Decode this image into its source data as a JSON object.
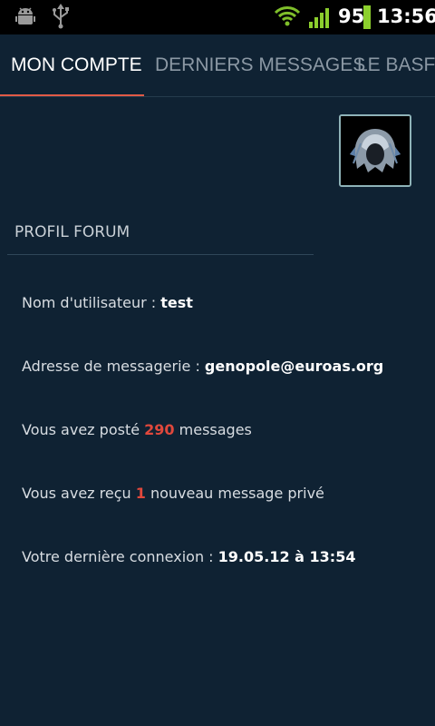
{
  "status_bar": {
    "battery_level": "95",
    "time": "13:56",
    "icons": [
      "android-debug-icon",
      "usb-icon",
      "wifi-icon",
      "signal-icon",
      "battery-icon"
    ]
  },
  "tabs": [
    {
      "label": "MON COMPTE",
      "active": true
    },
    {
      "label": "DERNIERS MESSAGES",
      "active": false
    },
    {
      "label": "LE BASFI",
      "active": false
    }
  ],
  "colors": {
    "background": "#0f2233",
    "accent": "#e15a46",
    "highlight_number": "#e0483c"
  },
  "profile": {
    "section_title": "PROFIL FORUM",
    "username_label": "Nom d'utilisateur : ",
    "username": "test",
    "email_label": "Adresse de messagerie : ",
    "email": "genopole@euroas.org",
    "posts_prefix": "Vous avez posté ",
    "posts_count": "290",
    "posts_suffix": " messages",
    "pm_prefix": "Vous avez reçu ",
    "pm_count": "1",
    "pm_suffix": " nouveau message privé",
    "last_login_label": "Votre dernière connexion : ",
    "last_login": "19.05.12 à 13:54"
  }
}
